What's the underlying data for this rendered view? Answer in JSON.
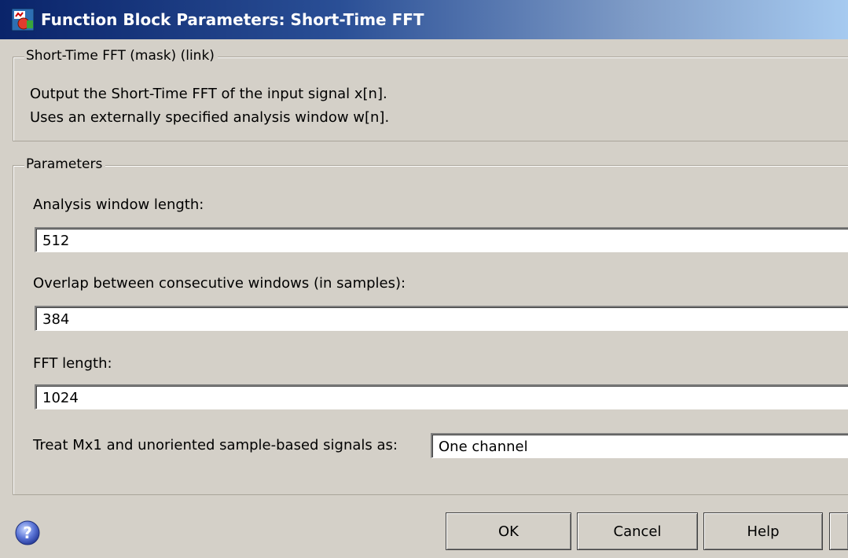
{
  "window": {
    "title": "Function Block Parameters: Short-Time FFT",
    "icon": "simulink-block-icon"
  },
  "description_group": {
    "legend": "Short-Time FFT (mask) (link)",
    "lines": [
      "Output the Short-Time FFT of the input signal x[n].",
      "Uses an externally specified analysis window w[n]."
    ]
  },
  "parameters_group": {
    "legend": "Parameters",
    "analysis_window_length": {
      "label": "Analysis window length:",
      "value": "512"
    },
    "overlap": {
      "label": "Overlap between consecutive windows (in samples):",
      "value": "384"
    },
    "fft_length": {
      "label": "FFT length:",
      "value": "1024"
    },
    "treat_signals": {
      "label": "Treat Mx1 and unoriented sample-based signals as:",
      "value": "One channel"
    }
  },
  "buttons": {
    "help_icon": "question-circle-icon",
    "ok": "OK",
    "cancel": "Cancel",
    "help": "Help"
  },
  "colors": {
    "titlebar_start": "#0a246a",
    "titlebar_end": "#a6caf0",
    "dialog_bg": "#d4d0c8"
  }
}
